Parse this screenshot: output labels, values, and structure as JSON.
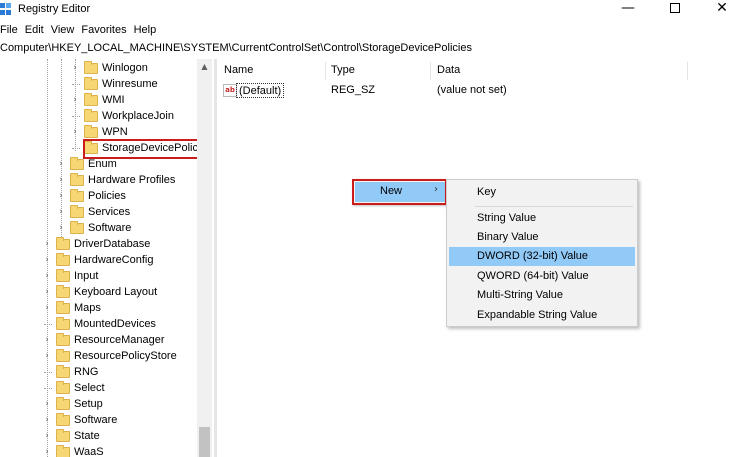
{
  "window": {
    "title": "Registry Editor"
  },
  "window_controls": {
    "minimize": "—",
    "maximize": "",
    "close": "✕"
  },
  "menubar": [
    "File",
    "Edit",
    "View",
    "Favorites",
    "Help"
  ],
  "address": "Computer\\HKEY_LOCAL_MACHINE\\SYSTEM\\CurrentControlSet\\Control\\StorageDevicePolicies",
  "tree": {
    "items": [
      {
        "label": "Winlogon",
        "level": 3,
        "expander": "›"
      },
      {
        "label": "Winresume",
        "level": 3,
        "expander": ""
      },
      {
        "label": "WMI",
        "level": 3,
        "expander": "›"
      },
      {
        "label": "WorkplaceJoin",
        "level": 3,
        "expander": ""
      },
      {
        "label": "WPN",
        "level": 3,
        "expander": "›"
      },
      {
        "label": "StorageDevicePolicies",
        "level": 3,
        "expander": "",
        "selected": true
      },
      {
        "label": "Enum",
        "level": 2,
        "expander": "›"
      },
      {
        "label": "Hardware Profiles",
        "level": 2,
        "expander": "›"
      },
      {
        "label": "Policies",
        "level": 2,
        "expander": "›"
      },
      {
        "label": "Services",
        "level": 2,
        "expander": "›"
      },
      {
        "label": "Software",
        "level": 2,
        "expander": "›"
      },
      {
        "label": "DriverDatabase",
        "level": 1,
        "expander": "›"
      },
      {
        "label": "HardwareConfig",
        "level": 1,
        "expander": "›"
      },
      {
        "label": "Input",
        "level": 1,
        "expander": "›"
      },
      {
        "label": "Keyboard Layout",
        "level": 1,
        "expander": "›"
      },
      {
        "label": "Maps",
        "level": 1,
        "expander": "›"
      },
      {
        "label": "MountedDevices",
        "level": 1,
        "expander": ""
      },
      {
        "label": "ResourceManager",
        "level": 1,
        "expander": "›"
      },
      {
        "label": "ResourcePolicyStore",
        "level": 1,
        "expander": "›"
      },
      {
        "label": "RNG",
        "level": 1,
        "expander": ""
      },
      {
        "label": "Select",
        "level": 1,
        "expander": ""
      },
      {
        "label": "Setup",
        "level": 1,
        "expander": "›"
      },
      {
        "label": "Software",
        "level": 1,
        "expander": "›"
      },
      {
        "label": "State",
        "level": 1,
        "expander": "›"
      },
      {
        "label": "WaaS",
        "level": 1,
        "expander": "›"
      }
    ]
  },
  "list": {
    "columns": [
      "Name",
      "Type",
      "Data"
    ],
    "rows": [
      {
        "icon": "ab",
        "name": "(Default)",
        "type": "REG_SZ",
        "data": "(value not set)"
      }
    ]
  },
  "context_menu": {
    "new_label": "New",
    "new_arrow": "›",
    "submenu": [
      "Key",
      "String Value",
      "Binary Value",
      "DWORD (32-bit) Value",
      "QWORD (64-bit) Value",
      "Multi-String Value",
      "Expandable String Value"
    ],
    "highlighted": "DWORD (32-bit) Value"
  },
  "colors": {
    "highlight": "#91c9f7",
    "annotation_box": "#cc1b1b",
    "folder": "#f7d674"
  },
  "icons": [
    "registry-editor-icon",
    "folder-icon",
    "string-value-icon",
    "chevron-right-icon",
    "scroll-up-icon"
  ]
}
